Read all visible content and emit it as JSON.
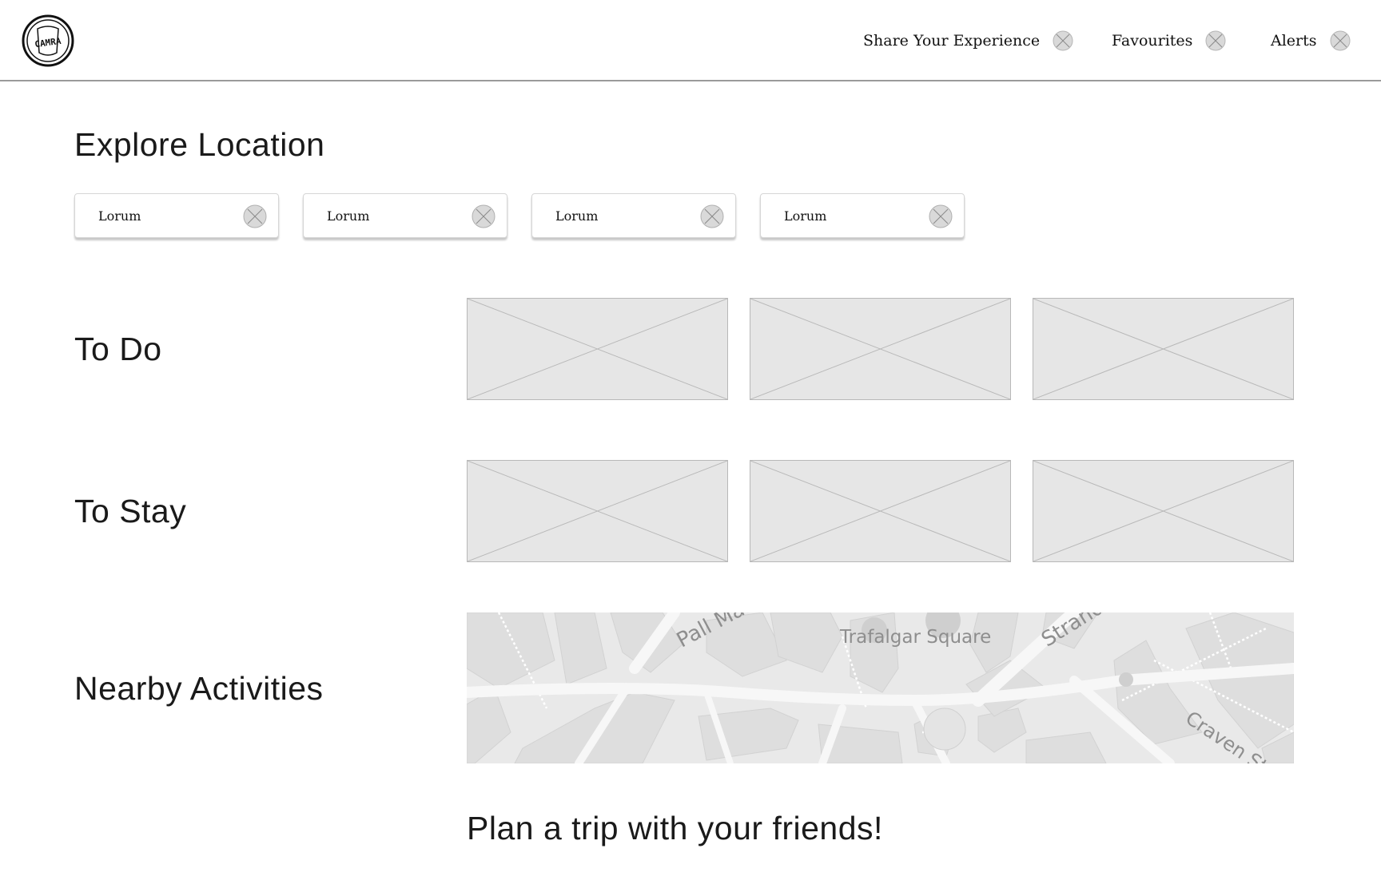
{
  "header": {
    "logo_icon": "camra-logo-icon",
    "logo_text": "CAMRA",
    "nav": [
      {
        "label": "Share Your Experience",
        "icon": "close-icon"
      },
      {
        "label": "Favourites",
        "icon": "close-icon"
      },
      {
        "label": "Alerts",
        "icon": "close-icon"
      }
    ]
  },
  "main": {
    "title": "Explore Location",
    "chips": [
      {
        "label": "Lorum",
        "icon": "close-icon"
      },
      {
        "label": "Lorum",
        "icon": "close-icon"
      },
      {
        "label": "Lorum",
        "icon": "close-icon"
      },
      {
        "label": "Lorum",
        "icon": "close-icon"
      }
    ],
    "sections": {
      "to_do": {
        "title": "To Do"
      },
      "to_stay": {
        "title": "To Stay"
      },
      "nearby": {
        "title": "Nearby Activities"
      }
    },
    "map": {
      "labels": [
        "Pall Mall",
        "Trafalgar Square",
        "Strand",
        "Craven St"
      ]
    },
    "cta": "Plan a trip with your friends!"
  },
  "colors": {
    "placeholder_fill": "#e6e6e6",
    "placeholder_stroke": "#b8b8b8",
    "icon_fill": "#d9d9d9",
    "map_bg": "#ececec",
    "header_rule": "#9a9a9a"
  }
}
